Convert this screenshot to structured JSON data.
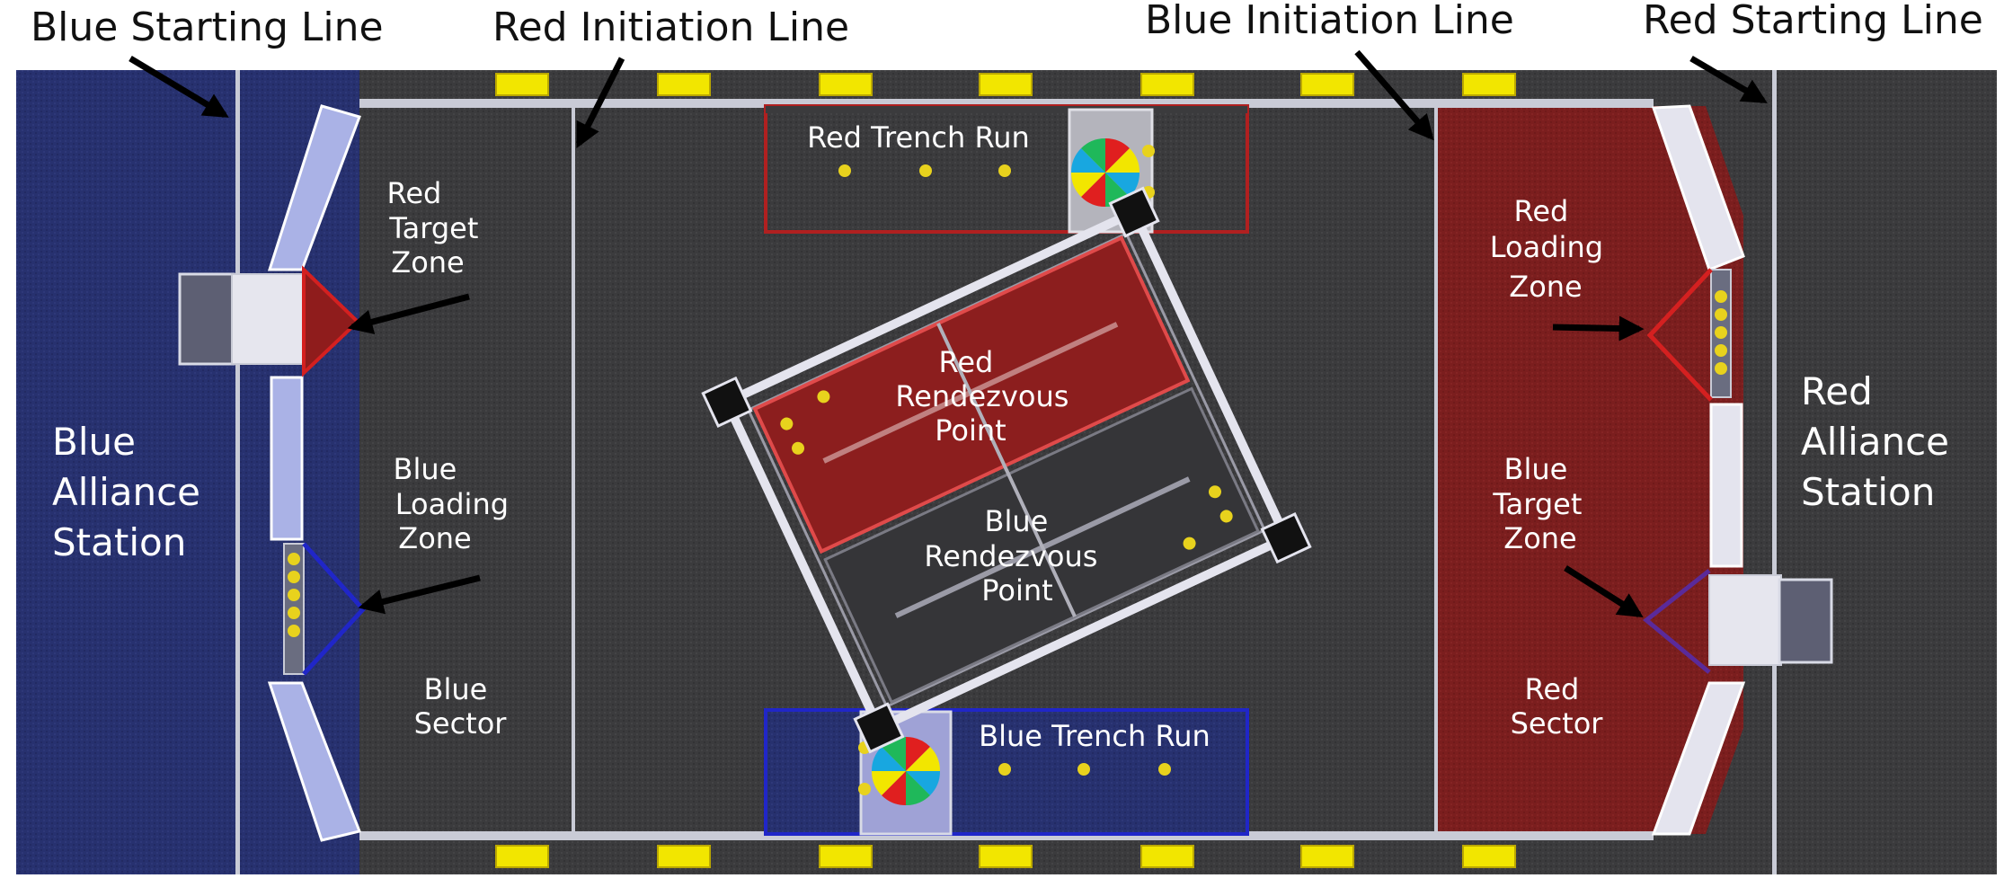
{
  "title_labels": {
    "blue_starting_line": "Blue Starting Line",
    "red_initiation_line": "Red Initiation Line",
    "blue_initiation_line": "Blue Initiation Line",
    "red_starting_line": "Red Starting Line"
  },
  "zones": {
    "red_target_zone": [
      "Red",
      "Target",
      "Zone"
    ],
    "blue_loading_zone": [
      "Blue",
      "Loading",
      "Zone"
    ],
    "blue_sector": [
      "Blue",
      "Sector"
    ],
    "red_trench_run": "Red Trench Run",
    "blue_trench_run": "Blue Trench Run",
    "red_rendezvous_point": [
      "Red",
      "Rendezvous",
      "Point"
    ],
    "blue_rendezvous_point": [
      "Blue",
      "Rendezvous",
      "Point"
    ],
    "red_loading_zone": [
      "Red",
      "Loading",
      "Zone"
    ],
    "blue_target_zone": [
      "Blue",
      "Target",
      "Zone"
    ],
    "red_sector": [
      "Red",
      "Sector"
    ]
  },
  "stations": {
    "blue_alliance_station": [
      "Blue",
      "Alliance",
      "Station"
    ],
    "red_alliance_station": [
      "Red",
      "Alliance",
      "Station"
    ]
  },
  "colors": {
    "blue_alliance": "#26306e",
    "red_alliance": "#7a1d1d",
    "carpet": "#3a3a3c",
    "field_border": "#c9cbd6",
    "power_cell": "#e8d21d",
    "marker_yellow": "#f2e600"
  }
}
